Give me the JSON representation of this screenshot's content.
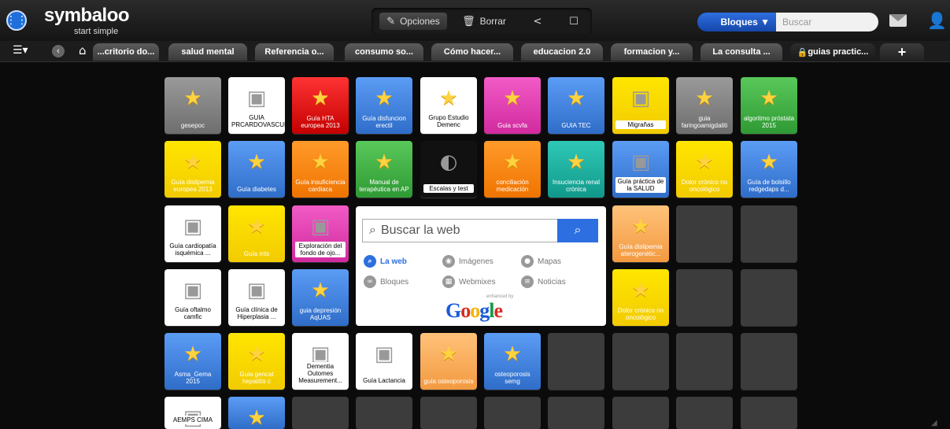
{
  "brand": {
    "name": "symbaloo",
    "tagline": "start simple"
  },
  "toolbar": {
    "options": "Opciones",
    "delete": "Borrar"
  },
  "search_top": {
    "mode": "Bloques",
    "placeholder": "Buscar"
  },
  "tabs": [
    "...critorio do...",
    "salud mental",
    "Referencia o...",
    "consumo so...",
    "Cómo hacer...",
    "educacion 2.0",
    "formacion y...",
    "La consulta ...",
    "guias practic..."
  ],
  "tiles": [
    {
      "label": "gesepoc",
      "style": "gray",
      "star": true
    },
    {
      "label": "GUIA PRCARDOVASCUI",
      "style": "white",
      "star": false
    },
    {
      "label": "Guía HTA europea 2013",
      "style": "red",
      "star": true
    },
    {
      "label": "Guía disfuncion erectil",
      "style": "blue",
      "star": true
    },
    {
      "label": "Grupo Estudio Demenc",
      "style": "white",
      "star": true
    },
    {
      "label": "Guia scvfa",
      "style": "pink",
      "star": true
    },
    {
      "label": "GUIA TEC",
      "style": "blue",
      "star": true
    },
    {
      "label": "Migrañas",
      "style": "yellow",
      "star": false
    },
    {
      "label": "guia faringoamigdaliti",
      "style": "gray",
      "star": true
    },
    {
      "label": "algoritmo próstata 2015",
      "style": "green",
      "star": true
    },
    {
      "label": "Guía dislipemia europea 2013",
      "style": "yellow",
      "star": true
    },
    {
      "label": "Guía diabetes",
      "style": "blue",
      "star": true
    },
    {
      "label": "Guía insuficiencia cardiaca",
      "style": "orange",
      "star": true
    },
    {
      "label": "Manual de terapéutica en AP",
      "style": "green",
      "star": true
    },
    {
      "label": "Escalas y test",
      "style": "black",
      "star": false
    },
    {
      "label": "conciliación medicación",
      "style": "orange",
      "star": true
    },
    {
      "label": "Insuciencia renal crónica",
      "style": "teal",
      "star": true
    },
    {
      "label": "Guía práctica de la SALUD",
      "style": "blue",
      "star": false
    },
    {
      "label": "Dolor crónico no oncológico",
      "style": "yellow",
      "star": true
    },
    {
      "label": "Guía de bolsillo redgedaps d...",
      "style": "blue",
      "star": true
    },
    {
      "label": "Guía cardiopatía isquémica ...",
      "style": "white",
      "star": false
    },
    {
      "label": "Guía mts",
      "style": "yellow",
      "star": true
    },
    {
      "label": "Exploración del fondo de ojo...",
      "style": "pink",
      "star": false
    },
    {
      "label": "Guía dislipemia aterogenétic...",
      "style": "peach",
      "star": true
    },
    {
      "label": "Guía oftalmo camfic",
      "style": "white",
      "star": false
    },
    {
      "label": "Guía clínica de Hiperplasia ...",
      "style": "white",
      "star": false
    },
    {
      "label": "guia depresión AqUAS",
      "style": "blue",
      "star": true
    },
    {
      "label": "Dolor crónico no oncológico",
      "style": "yellow",
      "star": true
    },
    {
      "label": "Asma_Gema 2015",
      "style": "blue",
      "star": true
    },
    {
      "label": "Guia gencat hepatitis c",
      "style": "yellow",
      "star": true
    },
    {
      "label": "Dementia Outomes Measurement...",
      "style": "white",
      "star": false
    },
    {
      "label": "Guía Lactancia",
      "style": "white",
      "star": false
    },
    {
      "label": "guía osteoporosis",
      "style": "peach",
      "star": true
    },
    {
      "label": "osteoporosis semg",
      "style": "blue",
      "star": true
    },
    {
      "label": "AEMPS CIMA",
      "style": "white",
      "star": false
    },
    {
      "label": "",
      "style": "blue",
      "star": true
    }
  ],
  "google": {
    "placeholder": "Buscar la web",
    "options": [
      {
        "label": "La web",
        "icon": "search-icon"
      },
      {
        "label": "Imágenes",
        "icon": "camera-icon"
      },
      {
        "label": "Mapas",
        "icon": "map-pin-icon"
      },
      {
        "label": "Bloques",
        "icon": "link-icon"
      },
      {
        "label": "Webmixes",
        "icon": "grid-icon"
      },
      {
        "label": "Noticias",
        "icon": "news-icon"
      }
    ],
    "enhanced": "enhanced by",
    "logo": "Google"
  },
  "colors": {
    "blue": "#2f6dc9",
    "yellow": "#ffe600",
    "red": "#e00000",
    "pink": "#d12a9f",
    "green": "#2f9a34",
    "orange": "#f07400",
    "teal": "#11998a"
  }
}
